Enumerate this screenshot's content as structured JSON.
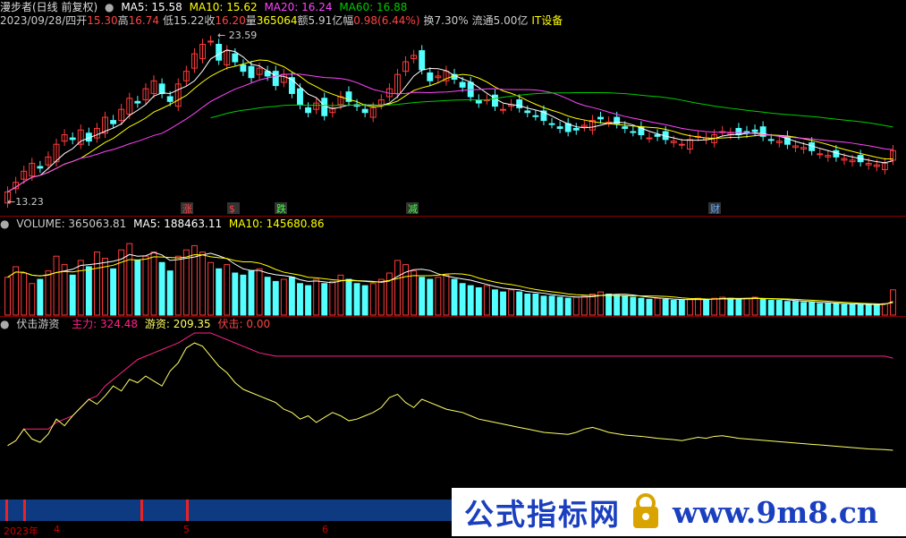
{
  "header": {
    "name": "漫步者(日线 前复权)",
    "ma5_label": "MA5: 15.58",
    "ma10_label": "MA10: 15.62",
    "ma20_label": "MA20: 16.24",
    "ma60_label": "MA60: 16.88",
    "date": "2023/09/28/四",
    "open_k": "开",
    "open": "15.30",
    "high_k": "高",
    "high": "16.74",
    "low_k": "低",
    "low": "15.22",
    "close_k": "收",
    "close": "16.20",
    "vol_k": "量",
    "vol": "365064",
    "amt": "额5.91亿",
    "range_k": "幅",
    "range": "0.98(6.44%)",
    "turn": "换7.30%",
    "float": "流通5.00亿",
    "industry": "IT设备"
  },
  "price_panel": {
    "high_label": "23.59",
    "low_label": "13.23",
    "events": [
      {
        "text": "涨",
        "color": "#ff4040"
      },
      {
        "text": "$",
        "color": "#ff4040"
      },
      {
        "text": "跌",
        "color": "#40ff40"
      },
      {
        "text": "减",
        "color": "#40ff40"
      },
      {
        "text": "财",
        "color": "#66aaff"
      }
    ]
  },
  "volume_panel": {
    "label": "VOLUME: 365063.81",
    "ma5": "MA5: 188463.11",
    "ma10": "MA10: 145680.86"
  },
  "indicator_panel": {
    "name": "伏击游资",
    "main_label": "主力: 324.48",
    "hot_label": "游资: 209.35",
    "ambush_label": "伏击: 0.00"
  },
  "xaxis": {
    "labels": [
      "2023年",
      "4",
      "5",
      "6"
    ]
  },
  "watermark": {
    "text": "公式指标网",
    "url": "www.9m8.cn"
  },
  "colors": {
    "up": "#ff3b3b",
    "down": "#54ffff",
    "ma5": "#ffffff",
    "ma10": "#ffff00",
    "ma20": "#ff44ff",
    "ma60": "#00cc00",
    "main": "#ff2288",
    "hot": "#ffff66"
  },
  "chart_data": [
    {
      "type": "candlestick",
      "title": "漫步者(日线 前复权)",
      "ylim": [
        13.0,
        24.0
      ],
      "high": 23.59,
      "low": 13.23,
      "close": [
        13.6,
        14.2,
        14.9,
        15.4,
        15.1,
        15.8,
        16.6,
        17.2,
        16.9,
        17.5,
        16.8,
        17.6,
        18.3,
        17.9,
        18.8,
        19.5,
        19.2,
        20.1,
        20.6,
        19.8,
        19.3,
        20.4,
        21.2,
        22.3,
        22.9,
        23.1,
        21.9,
        22.5,
        21.8,
        21.2,
        20.8,
        21.4,
        20.9,
        20.3,
        21.0,
        19.8,
        19.1,
        18.6,
        19.2,
        18.4,
        18.9,
        19.6,
        19.3,
        19.0,
        18.6,
        18.9,
        19.4,
        20.1,
        21.0,
        21.8,
        22.2,
        21.3,
        20.6,
        20.9,
        21.2,
        20.7,
        20.2,
        19.6,
        19.2,
        19.4,
        19.0,
        18.8,
        19.1,
        18.9,
        18.6,
        18.4,
        18.1,
        17.9,
        17.6,
        17.4,
        17.5,
        17.8,
        18.1,
        18.2,
        18.0,
        17.9,
        17.6,
        17.4,
        17.2,
        17.0,
        17.1,
        16.9,
        16.8,
        16.6,
        16.9,
        17.1,
        17.0,
        17.2,
        17.4,
        17.3,
        17.2,
        17.3,
        17.4,
        17.1,
        16.9,
        16.8,
        16.6,
        16.5,
        16.4,
        16.2,
        16.0,
        15.9,
        15.8,
        15.7,
        15.6,
        15.5,
        15.4,
        15.3,
        15.4,
        16.2
      ],
      "ma5_last": 15.58,
      "ma10_last": 15.62,
      "ma20_last": 16.24,
      "ma60_last": 16.88
    },
    {
      "type": "bar",
      "title": "VOLUME",
      "ylim": [
        0,
        400000
      ],
      "values": [
        180,
        230,
        200,
        150,
        170,
        210,
        280,
        240,
        190,
        260,
        230,
        300,
        270,
        220,
        310,
        340,
        260,
        280,
        300,
        250,
        210,
        280,
        310,
        330,
        300,
        250,
        220,
        240,
        200,
        190,
        210,
        220,
        180,
        160,
        170,
        180,
        150,
        140,
        170,
        150,
        160,
        190,
        170,
        150,
        140,
        150,
        170,
        200,
        260,
        240,
        210,
        180,
        170,
        180,
        190,
        170,
        150,
        140,
        130,
        140,
        120,
        110,
        120,
        110,
        100,
        100,
        90,
        90,
        85,
        80,
        85,
        90,
        100,
        110,
        100,
        95,
        90,
        85,
        80,
        75,
        80,
        75,
        70,
        70,
        75,
        80,
        75,
        80,
        85,
        80,
        75,
        80,
        85,
        75,
        70,
        70,
        65,
        65,
        60,
        60,
        55,
        55,
        55,
        50,
        50,
        50,
        50,
        50,
        55,
        120
      ],
      "value_scale": "thousands",
      "last": 365063.81,
      "ma5_last": 188463.11,
      "ma10_last": 145680.86
    },
    {
      "type": "line",
      "title": "伏击游资",
      "ylim": [
        0,
        400
      ],
      "series": [
        {
          "name": "主力",
          "last": 324.48
        },
        {
          "name": "游资",
          "last": 209.35
        },
        {
          "name": "伏击",
          "last": 0.0
        }
      ],
      "hot": [
        60,
        75,
        110,
        80,
        70,
        95,
        140,
        120,
        150,
        175,
        200,
        185,
        210,
        240,
        225,
        260,
        250,
        270,
        255,
        240,
        285,
        310,
        355,
        370,
        360,
        330,
        300,
        280,
        250,
        230,
        220,
        210,
        200,
        190,
        170,
        160,
        140,
        150,
        130,
        145,
        160,
        150,
        135,
        140,
        150,
        160,
        175,
        205,
        215,
        190,
        175,
        200,
        190,
        180,
        170,
        165,
        160,
        150,
        140,
        135,
        130,
        125,
        120,
        115,
        110,
        105,
        100,
        98,
        96,
        94,
        100,
        110,
        115,
        108,
        100,
        96,
        92,
        90,
        88,
        85,
        82,
        80,
        78,
        75,
        80,
        85,
        82,
        88,
        90,
        86,
        82,
        80,
        78,
        76,
        74,
        72,
        70,
        68,
        66,
        64,
        62,
        60,
        58,
        56,
        54,
        52,
        50,
        49,
        48,
        46
      ],
      "main": [
        60,
        75,
        110,
        110,
        110,
        110,
        130,
        140,
        150,
        175,
        200,
        210,
        240,
        260,
        280,
        300,
        320,
        330,
        340,
        350,
        360,
        370,
        385,
        400,
        400,
        400,
        390,
        380,
        370,
        360,
        350,
        340,
        335,
        330,
        330,
        330,
        330,
        330,
        330,
        330,
        330,
        330,
        330,
        330,
        330,
        330,
        330,
        330,
        330,
        330,
        330,
        330,
        330,
        330,
        330,
        330,
        330,
        330,
        330,
        330,
        330,
        330,
        330,
        330,
        330,
        330,
        330,
        330,
        330,
        330,
        330,
        330,
        330,
        330,
        330,
        330,
        330,
        330,
        330,
        330,
        330,
        330,
        330,
        330,
        330,
        330,
        330,
        330,
        330,
        330,
        330,
        330,
        330,
        330,
        330,
        330,
        330,
        330,
        330,
        330,
        330,
        330,
        330,
        330,
        330,
        330,
        330,
        330,
        330,
        324
      ]
    }
  ]
}
